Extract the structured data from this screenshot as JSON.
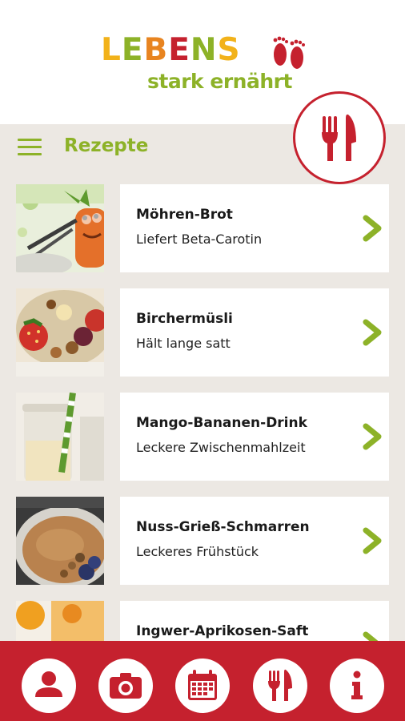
{
  "logo": {
    "letters": [
      "L",
      "E",
      "B",
      "E",
      "N",
      "S"
    ],
    "letter_colors": [
      "#f2b21a",
      "#8db228",
      "#e88420",
      "#c5212e",
      "#8db228",
      "#f2b21a"
    ],
    "subtitle": "stark ernährt"
  },
  "header": {
    "title": "Rezepte",
    "menu_icon": "hamburger-icon",
    "badge_icon": "fork-knife-icon"
  },
  "recipes": [
    {
      "title": "Möhren-Brot",
      "subtitle": "Liefert Beta-Carotin"
    },
    {
      "title": "Birchermüsli",
      "subtitle": "Hält lange satt"
    },
    {
      "title": "Mango-Bananen-Drink",
      "subtitle": "Leckere Zwischenmahlzeit"
    },
    {
      "title": "Nuss-Grieß-Schmarren",
      "subtitle": "Leckeres Frühstück"
    },
    {
      "title": "Ingwer-Aprikosen-Saft",
      "subtitle": ""
    }
  ],
  "bottom_nav": [
    {
      "icon": "person-icon"
    },
    {
      "icon": "camera-icon"
    },
    {
      "icon": "calendar-icon"
    },
    {
      "icon": "fork-knife-icon"
    },
    {
      "icon": "info-icon"
    }
  ],
  "colors": {
    "brand_red": "#c5212e",
    "brand_green": "#8db228",
    "background": "#ece8e3"
  }
}
